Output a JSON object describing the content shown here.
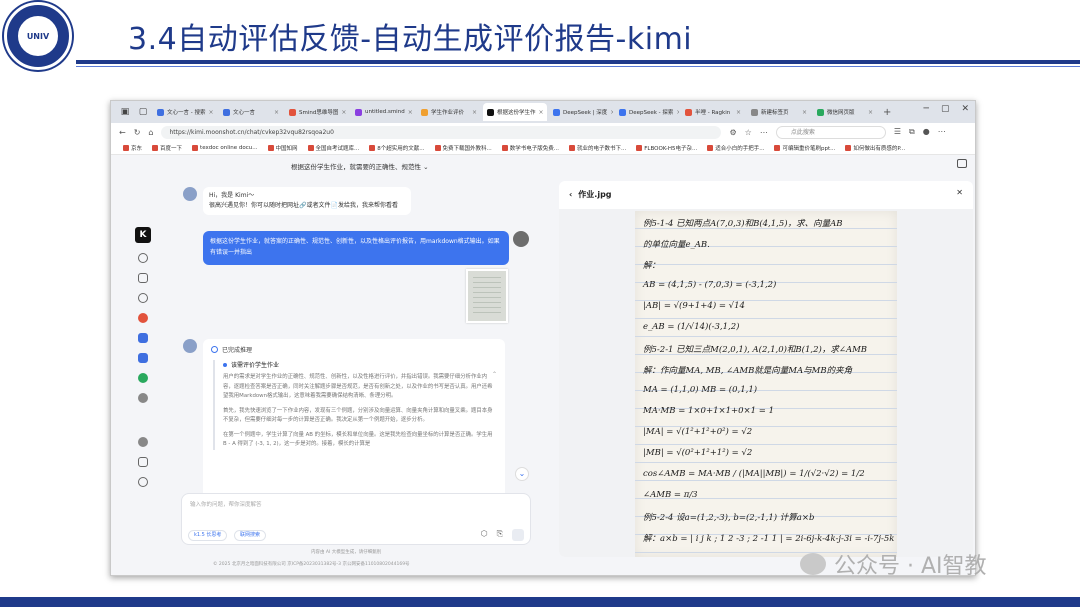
{
  "slide": {
    "title": "3.4自动评估反馈-自动生成评价报告-kimi",
    "logo_text": "UNIV"
  },
  "browser": {
    "tabs": [
      {
        "label": "文心一言 - 搜索",
        "color": "#3f6fe0",
        "active": false
      },
      {
        "label": "文心一言",
        "color": "#3f6fe0",
        "active": false
      },
      {
        "label": "Smind思维导图",
        "color": "#e2533c",
        "active": false
      },
      {
        "label": "untitled.smind",
        "color": "#8a3fe0",
        "active": false
      },
      {
        "label": "学生作业评价",
        "color": "#f0a030",
        "active": false
      },
      {
        "label": "根据这份学生作",
        "color": "#111111",
        "active": true
      },
      {
        "label": "DeepSeek | 深度",
        "color": "#3d74ee",
        "active": false
      },
      {
        "label": "DeepSeek - 探索",
        "color": "#3d74ee",
        "active": false
      },
      {
        "label": "半哩 - Ragkin",
        "color": "#e2533c",
        "active": false
      },
      {
        "label": "新建标签页",
        "color": "#888888",
        "active": false
      },
      {
        "label": "微信网页版",
        "color": "#2aa95e",
        "active": false
      }
    ],
    "url": "https://kimi.moonshot.cn/chat/cvkep32vqu82rsqoa2u0",
    "search_placeholder": "点此搜索",
    "bookmarks": [
      "京东",
      "百度一下",
      "texdoc online docu...",
      "中国知网",
      "全国自考试题库...",
      "8个超实用的文献...",
      "免费下载国外教科...",
      "数学书电子版免费...",
      "就业的电子数书下...",
      "FLBOOK-H5电子杂...",
      "适合小白的手把手...",
      "可编辑重价笔刷ppt...",
      "如何做出有质感的P..."
    ]
  },
  "app": {
    "conversation_title": "根据这份学生作业，就需要的正确性、规范性",
    "bot_greeting_line1": "Hi，我是 Kimi～",
    "bot_greeting_line2": "很高兴遇见你！你可以随时把网址🔗或者文件📄发给我，我来帮你看看",
    "user_message": "根据这份学生作业，就答案的正确性、规范性、创新性，以及性格出评价报告，用markdown格式输出。如果有错误一并指出",
    "answer_status": "已完成推理",
    "reason_title": "该需评价学生作业",
    "reason_paragraphs": [
      "用户的需求是对学生作业的正确性、规范性、创新性，以及性格进行评价，并指出错误。我需要仔细分析作业内容，逐题检查答案是否正确，同时关注解题步骤是否规范，是否有创新之处，以及作业的书写是否认真。用户还希望我用Markdown格式输出，这意味着我需要确保结构清晰、条理分明。",
      "首先，我先快速浏览了一下作业内容，发现有三个例题，分别涉及向量运算、向量夹角计算和向量叉乘。题目本身不复杂，但需要仔细对每一步的计算是否正确。我决定从第一个例题开始，逐步分析。",
      "在第一个例题中，学生计算了向量 AB 的坐标，模长和单位向量。这是我先检查向量坐标的计算是否正确。学生用 B - A 得到了 (-3, 1, 2)，这一步是对的。接着，模长的计算是"
    ],
    "input_placeholder": "输入你的问题，帮你深度解答",
    "chip_think": "k1.5 长思考",
    "chip_search": "联网搜索",
    "disclaimer": "内容由 AI 大模型生成，请仔细甄别",
    "footer": "© 2025 北京月之暗面科技有限公司    京ICP备2023031382号-3    京公网安备11010802044169号",
    "rail_logo": "K"
  },
  "viewer": {
    "title": "作业.jpg",
    "handwriting": [
      "例5-1-4  已知两点A(7,0,3)和B(4,1,5)，求、向量AB",
      "的单位向量e_AB.",
      "解：",
      "AB = (4,1,5) - (7,0,3) = (-3,1,2)",
      "|AB| = √(9+1+4) = √14",
      "e_AB = (1/√14)(-3,1,2)",
      "例5-2-1  已知三点M(2,0,1), A(2,1,0)和B(1,2)，求∠AMB",
      "解：作向量MA, MB, ∠AMB就是向量MA与MB的夹角",
      "MA = (1,1,0)   MB = (0,1,1)",
      "MA·MB = 1×0+1×1+0×1 = 1",
      "|MA| = √(1²+1²+0²) = √2",
      "|MB| = √(0²+1²+1²) = √2",
      "cos∠AMB = MA·MB / (|MA||MB|) = 1/(√2·√2) = 1/2",
      "∠AMB = π/3",
      "例5-2-4  设a=(1,2,-3), b=(2,-1,1) 计算a×b",
      "解：a×b = | i  j  k ; 1  2  -3 ; 2  -1  1 | = 2i-6j-k-4k-j-3i = -i-7j-5k"
    ]
  },
  "watermark": "公众号 · AI智教"
}
